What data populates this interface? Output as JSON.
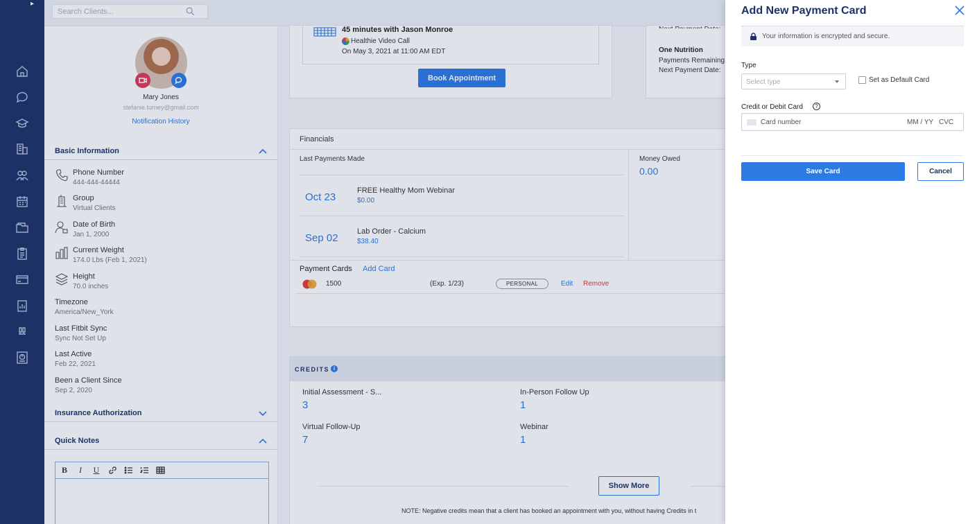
{
  "search": {
    "placeholder": "Search Clients..."
  },
  "client": {
    "name": "Mary Jones",
    "email": "stefanie.turney@gmail.com",
    "notification_link": "Notification History"
  },
  "basic_info": {
    "title": "Basic Information",
    "fields": [
      {
        "label": "Phone Number",
        "value": "444-444-44444",
        "icon": "phone-icon"
      },
      {
        "label": "Group",
        "value": "Virtual Clients",
        "icon": "building-icon"
      },
      {
        "label": "Date of Birth",
        "value": "Jan 1, 2000",
        "icon": "user-calendar-icon"
      },
      {
        "label": "Current Weight",
        "value": "174.0 Lbs (Feb 1, 2021)",
        "icon": "weight-chart-icon"
      },
      {
        "label": "Height",
        "value": "70.0 inches",
        "icon": "layers-icon"
      },
      {
        "label": "Timezone",
        "value": "America/New_York"
      },
      {
        "label": "Last Fitbit Sync",
        "value": "Sync Not Set Up"
      },
      {
        "label": "Last Active",
        "value": "Feb 22, 2021"
      },
      {
        "label": "Been a Client Since",
        "value": "Sep 2, 2020"
      }
    ]
  },
  "insurance": {
    "title": "Insurance Authorization"
  },
  "quick_notes": {
    "title": "Quick Notes"
  },
  "appointment": {
    "title": "45 minutes with Jason Monroe",
    "via": "Healthie Video Call",
    "when": "On May 3, 2021 at 11:00 AM EDT",
    "book_button": "Book Appointment"
  },
  "plan": {
    "cut_text": "Next Payment Date:",
    "title": "One Nutrition",
    "payments_remaining": "Payments Remaining",
    "next_payment": "Next Payment Date:"
  },
  "financials": {
    "title": "Financials",
    "last_payments_label": "Last Payments Made",
    "payments": [
      {
        "date": "Oct 23",
        "desc": "FREE Healthy Mom Webinar",
        "amount": "$0.00"
      },
      {
        "date": "Sep 02",
        "desc": "Lab Order - Calcium",
        "amount": "$38.40"
      }
    ],
    "money_owed_label": "Money Owed",
    "money_owed_value": "0.00",
    "payment_cards_label": "Payment Cards",
    "add_card": "Add Card",
    "card": {
      "last4": "1500",
      "exp": "(Exp. 1/23)",
      "badge": "PERSONAL",
      "edit": "Edit",
      "remove": "Remove"
    }
  },
  "credits": {
    "title": "CREDITS",
    "items": [
      {
        "name": "Initial Assessment - S...",
        "value": "3"
      },
      {
        "name": "In-Person Follow Up",
        "value": "1"
      },
      {
        "name": "Virtual Follow-Up",
        "value": "7"
      },
      {
        "name": "Webinar",
        "value": "1"
      }
    ],
    "show_more": "Show More",
    "note": "NOTE: Negative credits mean that a client has booked an appointment with you, without having Credits in t"
  },
  "panel": {
    "title": "Add New Payment Card",
    "secure_text": "Your information is encrypted and secure.",
    "type_label": "Type",
    "type_placeholder": "Select type",
    "default_label": "Set as Default Card",
    "card_label": "Credit or Debit Card",
    "card_number_placeholder": "Card number",
    "exp_placeholder": "MM / YY",
    "cvc_placeholder": "CVC",
    "save_button": "Save Card",
    "cancel_button": "Cancel"
  },
  "colors": {
    "nav": "#1d3166",
    "accent": "#2c7be5",
    "danger": "#e03a3a"
  }
}
